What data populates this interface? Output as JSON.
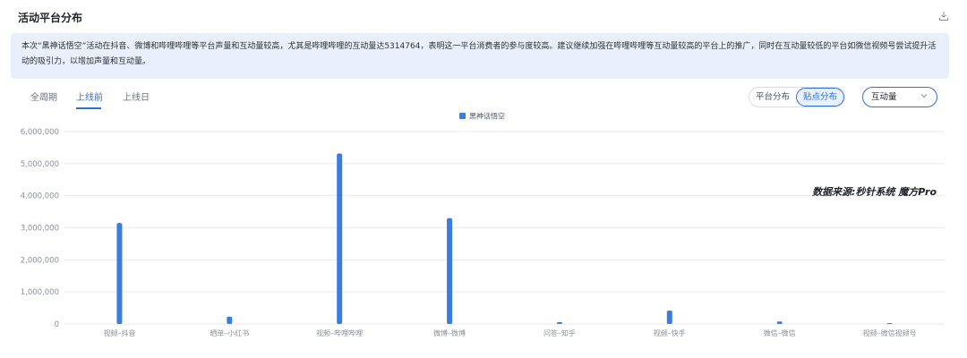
{
  "header": {
    "title": "活动平台分布",
    "download_icon": "download-icon"
  },
  "summary": {
    "text": "本次“黑神话悟空”活动在抖音、微博和哔哩哔哩等平台声量和互动量较高，尤其是哔哩哔哩的互动量达5314764，表明这一平台消费者的参与度较高。建议继续加强在哔哩哔哩等互动量较高的平台上的推广，同时在互动量较低的平台如微信视频号尝试提升活动的吸引力，以增加声量和互动量。"
  },
  "tabs": [
    {
      "label": "全周期",
      "active": false
    },
    {
      "label": "上线前",
      "active": true
    },
    {
      "label": "上线日",
      "active": false
    }
  ],
  "toggle": {
    "options": [
      "平台分布",
      "贴点分布"
    ],
    "active_index": 1
  },
  "metric_select": {
    "value": "互动量",
    "icon": "chevron-down-icon"
  },
  "colors": {
    "accent": "#2e6fd8",
    "bar": "#3b7ddd",
    "grid": "#e8eaee",
    "axis_text": "#8a8f99"
  },
  "chart_data": {
    "type": "bar",
    "categories": [
      "视频–抖音",
      "晒单–小红书",
      "视频–哔哩哔哩",
      "微博–微博",
      "问答–知乎",
      "视频–快手",
      "微信–微信",
      "视频–微信视频号"
    ],
    "series": [
      {
        "name": "黑神话悟空",
        "values": [
          3150000,
          230000,
          5314764,
          3300000,
          60000,
          420000,
          80000,
          5000
        ]
      }
    ],
    "ylim": [
      0,
      6000000
    ],
    "yticks": [
      0,
      1000000,
      2000000,
      3000000,
      4000000,
      5000000,
      6000000
    ],
    "ytick_labels": [
      "0",
      "1,000,000",
      "2,000,000",
      "3,000,000",
      "4,000,000",
      "5,000,000",
      "6,000,000"
    ],
    "legend_position": "top-center",
    "grid": true,
    "annotation": "数据来源:秒针系统 魔方Pro",
    "title": "",
    "xlabel": "",
    "ylabel": ""
  }
}
